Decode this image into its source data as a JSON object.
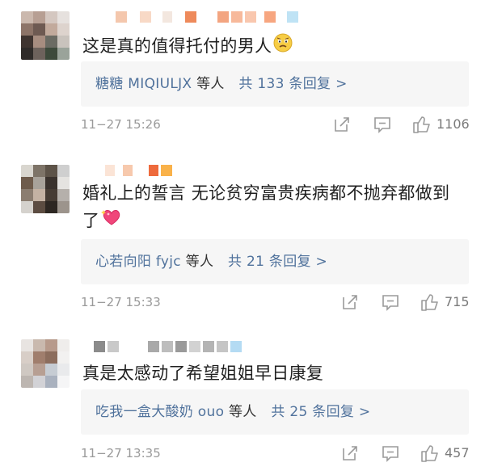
{
  "comments": [
    {
      "text": "这是真的值得托付的男人",
      "emoji_icon": "worried-face-icon",
      "reply": {
        "users": "糖糖 MIQIULJX",
        "suffix": "等人",
        "total": "共 133 条回复 >"
      },
      "time": "11−27 15:26",
      "likes": "1106"
    },
    {
      "text": "婚礼上的誓言 无论贫穷富贵疾病都不抛弃都做到了",
      "emoji_icon": "sparkling-heart-icon",
      "reply": {
        "users": "心若向阳 fyjc",
        "suffix": "等人",
        "total": "共 21 条回复 >"
      },
      "time": "11−27 15:33",
      "likes": "715"
    },
    {
      "text": "真是太感动了希望姐姐早日康复",
      "emoji_icon": "",
      "reply": {
        "users": "吃我一盒大酸奶 ouo",
        "suffix": "等人",
        "total": "共 25 条回复 >"
      },
      "time": "11−27 13:35",
      "likes": "457"
    }
  ],
  "colors": {
    "link": "#50729c",
    "meta": "#9a9a9a",
    "reply_bg": "#f6f6f6"
  },
  "icons": [
    "share-icon",
    "comment-icon",
    "like-icon"
  ]
}
